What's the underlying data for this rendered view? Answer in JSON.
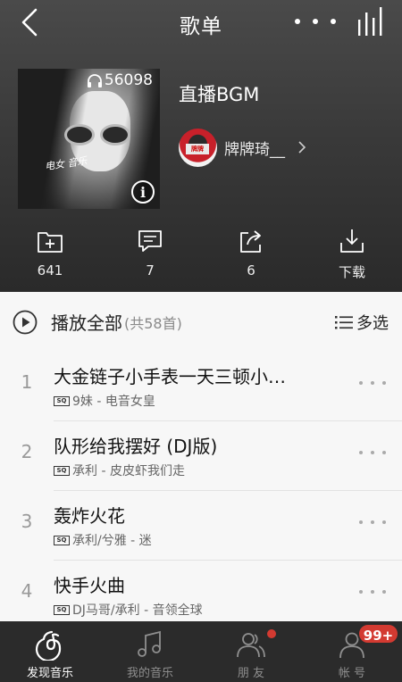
{
  "nav": {
    "title": "歌单"
  },
  "playlist": {
    "title": "直播BGM",
    "play_count": "56098",
    "creator": "牌牌琦__",
    "avatar_text": "牌牌",
    "cover_scrawl": "电女 音乐"
  },
  "actions": [
    {
      "label": "641",
      "icon": "add-folder-icon"
    },
    {
      "label": "7",
      "icon": "comment-icon"
    },
    {
      "label": "6",
      "icon": "share-icon"
    },
    {
      "label": "下载",
      "icon": "download-icon"
    }
  ],
  "list_header": {
    "play_all": "播放全部",
    "count": "(共58首)",
    "multi_select": "多选"
  },
  "songs": [
    {
      "index": "1",
      "title": "大金链子小手表一天三顿小…",
      "quality": "SQ",
      "artist_album": "9妹 - 电音女皇"
    },
    {
      "index": "2",
      "title": "队形给我摆好 (DJ版)",
      "quality": "SQ",
      "artist_album": "承利 - 皮皮虾我们走"
    },
    {
      "index": "3",
      "title": "轰炸火花",
      "quality": "SQ",
      "artist_album": "承利/兮雅 - 迷"
    },
    {
      "index": "4",
      "title": "快手火曲",
      "quality": "SQ",
      "artist_album": "DJ马哥/承利 - 音领全球"
    }
  ],
  "tabbar": [
    {
      "label": "发现音乐",
      "icon": "netease-music-icon",
      "active": true
    },
    {
      "label": "我的音乐",
      "icon": "music-note-icon",
      "active": false
    },
    {
      "label": "朋 友",
      "icon": "friends-icon",
      "active": false
    },
    {
      "label": "帐 号",
      "icon": "account-icon",
      "active": false
    }
  ],
  "badges": {
    "account": "99+"
  },
  "colors": {
    "accent": "#d33a31",
    "tabbar_bg": "#2b2b2b",
    "list_bg": "#f7f7f7"
  }
}
